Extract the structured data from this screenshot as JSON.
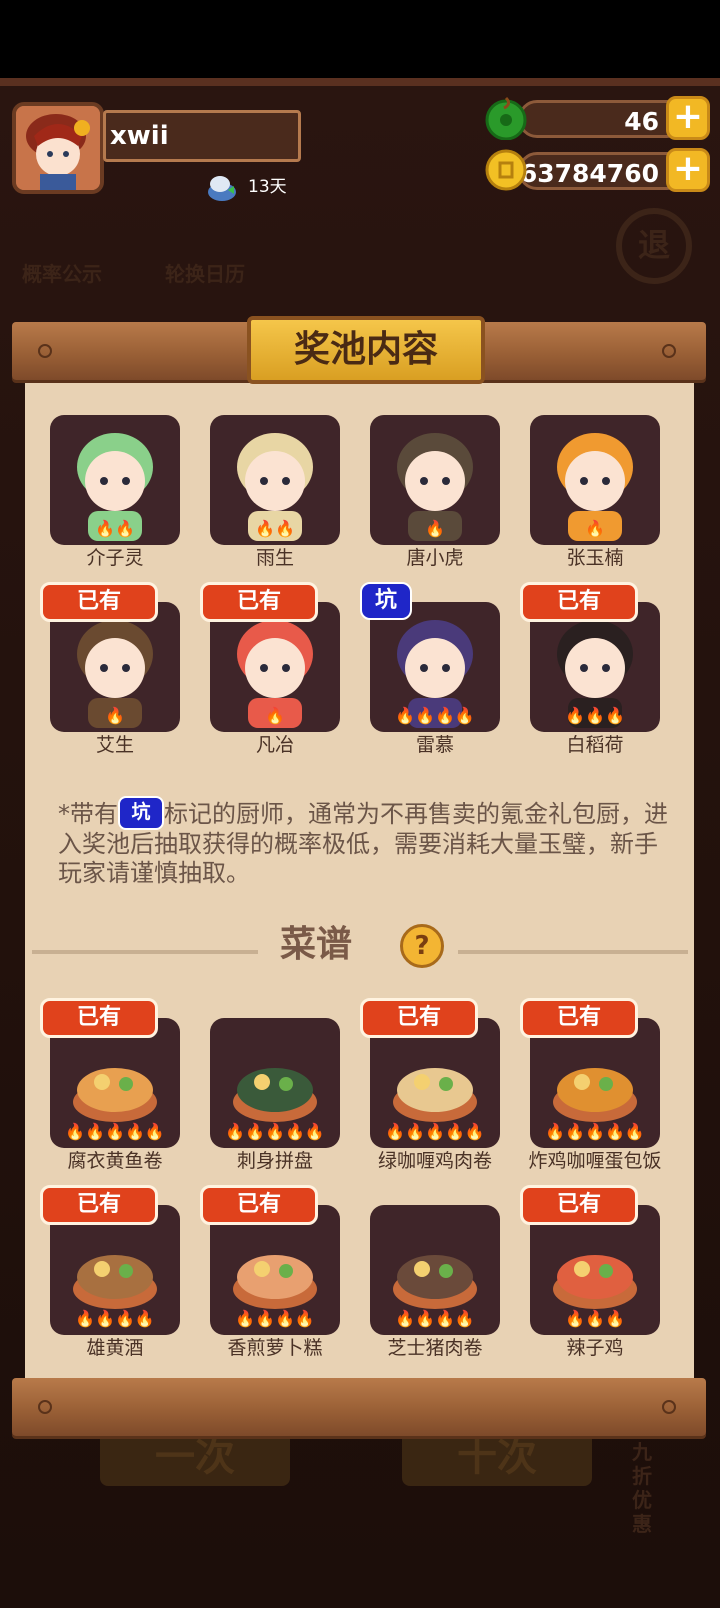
{
  "user": {
    "name": "xwii",
    "days": "13天"
  },
  "resources": {
    "jade": "46",
    "coins": "63784760"
  },
  "background": {
    "prob_label": "概率公示",
    "calendar_label": "轮换日历",
    "exit_label": "退",
    "single_label": "一次",
    "ten_label": "十次",
    "discount_label": "九折优惠"
  },
  "modal": {
    "title": "奖池内容",
    "chefs": [
      {
        "name": "介子灵",
        "owned": false,
        "pit": false,
        "stars": 2
      },
      {
        "name": "雨生",
        "owned": false,
        "pit": false,
        "stars": 2
      },
      {
        "name": "唐小虎",
        "owned": false,
        "pit": false,
        "stars": 1
      },
      {
        "name": "张玉楠",
        "owned": false,
        "pit": false,
        "stars": 1
      },
      {
        "name": "艾生",
        "owned": true,
        "pit": false,
        "stars": 1
      },
      {
        "name": "凡冶",
        "owned": true,
        "pit": false,
        "stars": 1
      },
      {
        "name": "雷慕",
        "owned": false,
        "pit": true,
        "stars": 4
      },
      {
        "name": "白稻荷",
        "owned": true,
        "pit": false,
        "stars": 3
      }
    ],
    "owned_label": "已有",
    "pit_label": "坑",
    "note_prefix": "*带有",
    "note_suffix": "标记的厨师，通常为不再售卖的氪金礼包厨，进入奖池后抽取获得的概率极低，需要消耗大量玉璧，新手玩家请谨慎抽取。",
    "recipes_title": "菜谱",
    "help_icon": "?",
    "recipes": [
      {
        "name": "腐衣黄鱼卷",
        "owned": true,
        "stars": 5
      },
      {
        "name": "刺身拼盘",
        "owned": false,
        "stars": 5
      },
      {
        "name": "绿咖喱鸡肉卷",
        "owned": true,
        "stars": 5
      },
      {
        "name": "炸鸡咖喱蛋包饭",
        "owned": true,
        "stars": 5
      },
      {
        "name": "雄黄酒",
        "owned": true,
        "stars": 4
      },
      {
        "name": "香煎萝卜糕",
        "owned": true,
        "stars": 4
      },
      {
        "name": "芝士猪肉卷",
        "owned": false,
        "stars": 4
      },
      {
        "name": "辣子鸡",
        "owned": true,
        "stars": 3
      }
    ]
  },
  "colors": {
    "owned_badge": "#e0421c",
    "pit_badge": "#1f26c8",
    "card_bg": "#3f2529",
    "panel_bg": "#e8d2b4"
  }
}
